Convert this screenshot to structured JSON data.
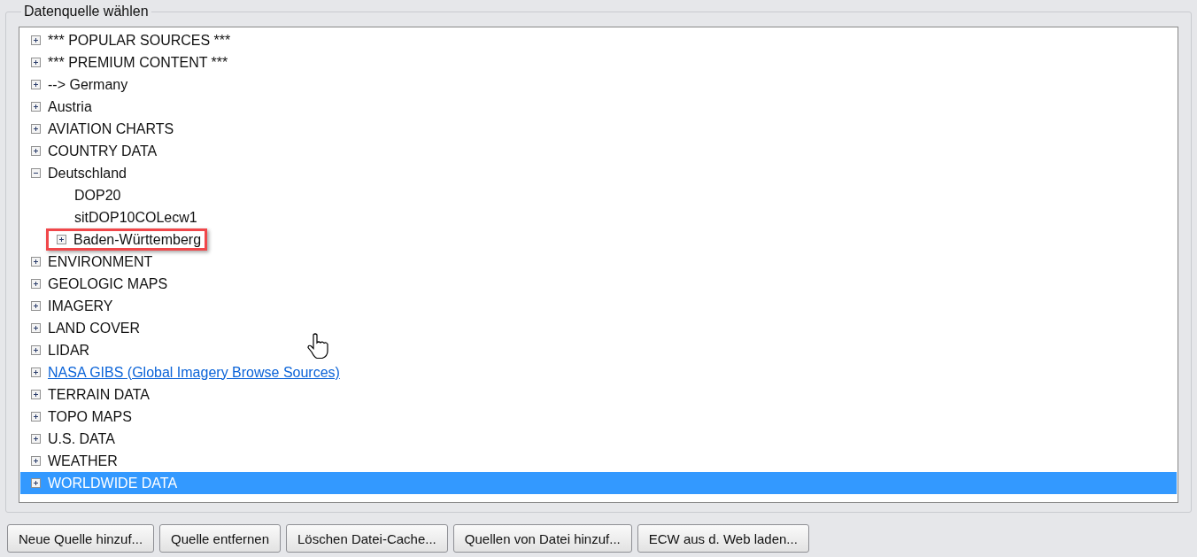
{
  "group_title": "Datenquelle wählen",
  "tree": [
    {
      "label": "*** POPULAR SOURCES ***",
      "expanded": false,
      "selected": false
    },
    {
      "label": "*** PREMIUM CONTENT ***",
      "expanded": false,
      "selected": false
    },
    {
      "label": "--> Germany",
      "expanded": false,
      "selected": false
    },
    {
      "label": "Austria",
      "expanded": false,
      "selected": false
    },
    {
      "label": "AVIATION CHARTS",
      "expanded": false,
      "selected": false
    },
    {
      "label": "COUNTRY DATA",
      "expanded": false,
      "selected": false
    },
    {
      "label": "Deutschland",
      "expanded": true,
      "selected": false,
      "children": [
        {
          "label": "DOP20",
          "selected": false
        },
        {
          "label": "sitDOP10COLecw1",
          "selected": false
        },
        {
          "label": "Baden-Württemberg",
          "expanded": false,
          "selected": false,
          "highlighted": true
        }
      ]
    },
    {
      "label": "ENVIRONMENT",
      "expanded": false,
      "selected": false
    },
    {
      "label": "GEOLOGIC MAPS",
      "expanded": false,
      "selected": false
    },
    {
      "label": "IMAGERY",
      "expanded": false,
      "selected": false
    },
    {
      "label": "LAND COVER",
      "expanded": false,
      "selected": false
    },
    {
      "label": "LIDAR",
      "expanded": false,
      "selected": false
    },
    {
      "label": "NASA GIBS (Global Imagery Browse Sources)",
      "kind": "link",
      "expanded": false,
      "selected": false
    },
    {
      "label": "TERRAIN DATA",
      "expanded": false,
      "selected": false
    },
    {
      "label": "TOPO MAPS",
      "expanded": false,
      "selected": false
    },
    {
      "label": "U.S. DATA",
      "expanded": false,
      "selected": false
    },
    {
      "label": "WEATHER",
      "expanded": false,
      "selected": false
    },
    {
      "label": "WORLDWIDE DATA",
      "expanded": false,
      "selected": true
    }
  ],
  "buttons": [
    "Neue Quelle hinzuf...",
    "Quelle entfernen",
    "Löschen Datei-Cache...",
    "Quellen von Datei hinzuf...",
    "ECW aus d. Web laden..."
  ]
}
